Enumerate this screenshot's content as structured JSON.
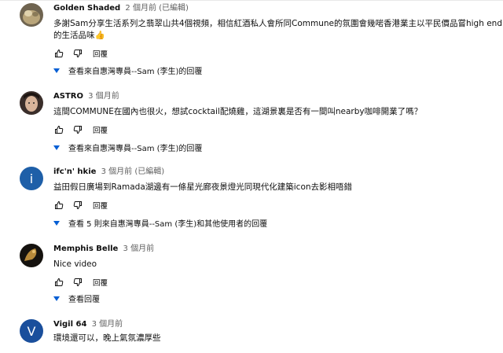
{
  "comments": [
    {
      "author": "Golden Shaded",
      "time": "2 個月前 (已編輯)",
      "text_line1": "多謝Sam分享生活系列之翡翠山共4個視頻，相信紅酒私人會所同Commune的氛圍會幾啱香港業主以平民價品嘗high end",
      "text_line2": "的生活品味👍",
      "reply_label": "回覆",
      "view_replies": "查看來自惠灣專員--Sam (李生)的回覆"
    },
    {
      "author": "ASTRO",
      "time": "3 個月前",
      "text_line1": "這間COMMUNE在國內也很火，想試cocktail配燒雞，這湖景裏是否有一間叫nearby咖啡開業了嗎？",
      "reply_label": "回覆",
      "view_replies": "查看來自惠灣專員--Sam (李生)的回覆"
    },
    {
      "author": "ifc'n' hkie",
      "time": "3 個月前 (已編輯)",
      "avatar_letter": "i",
      "text_line1": "益田假日廣場到Ramada湖邊有一條星光廊夜景燈光同現代化建築icon去影相唔錯",
      "reply_label": "回覆",
      "view_replies": "查看 5 則來自惠灣專員--Sam (李生)和其他使用者的回覆"
    },
    {
      "author": "Memphis Belle",
      "time": "3 個月前",
      "text_line1": "Nice video",
      "reply_label": "回覆",
      "view_replies": "查看回覆"
    },
    {
      "author": "Vigil 64",
      "time": "3 個月前",
      "avatar_letter": "V",
      "text_line1": "環境還可以，晚上氣氛濃厚些"
    }
  ],
  "colors": {
    "avatar_ifc": "#1e5fa8",
    "avatar_vigil": "#1a4f9c",
    "link_blue": "#065fd4"
  }
}
